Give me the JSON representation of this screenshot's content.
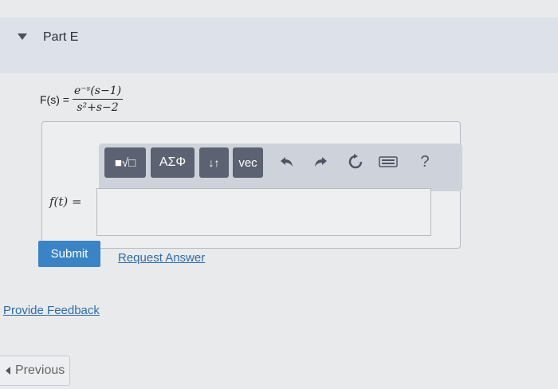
{
  "part": {
    "title": "Part E"
  },
  "prompt": {
    "lhs": "F(s) =",
    "numerator": "e⁻ˢ(s−1)",
    "denominator": "s²+s−2"
  },
  "toolbar": {
    "templates_label": "■√□",
    "greek_label": "AΣΦ",
    "arrows_label": "↓↑",
    "vec_label": "vec",
    "help_label": "?"
  },
  "answer": {
    "label": "f(t) =",
    "value": ""
  },
  "actions": {
    "submit_label": "Submit",
    "request_answer_label": "Request Answer"
  },
  "footer": {
    "feedback_label": "Provide Feedback",
    "previous_label": "Previous"
  },
  "colors": {
    "accent": "#3a84c5",
    "link": "#2f6ca6",
    "toolbar_button": "#5c6271"
  },
  "icons": {
    "collapse": "caret-down-icon",
    "undo": "undo-icon",
    "redo": "redo-icon",
    "reset": "reset-icon",
    "keyboard": "keyboard-icon",
    "help": "help-icon"
  }
}
